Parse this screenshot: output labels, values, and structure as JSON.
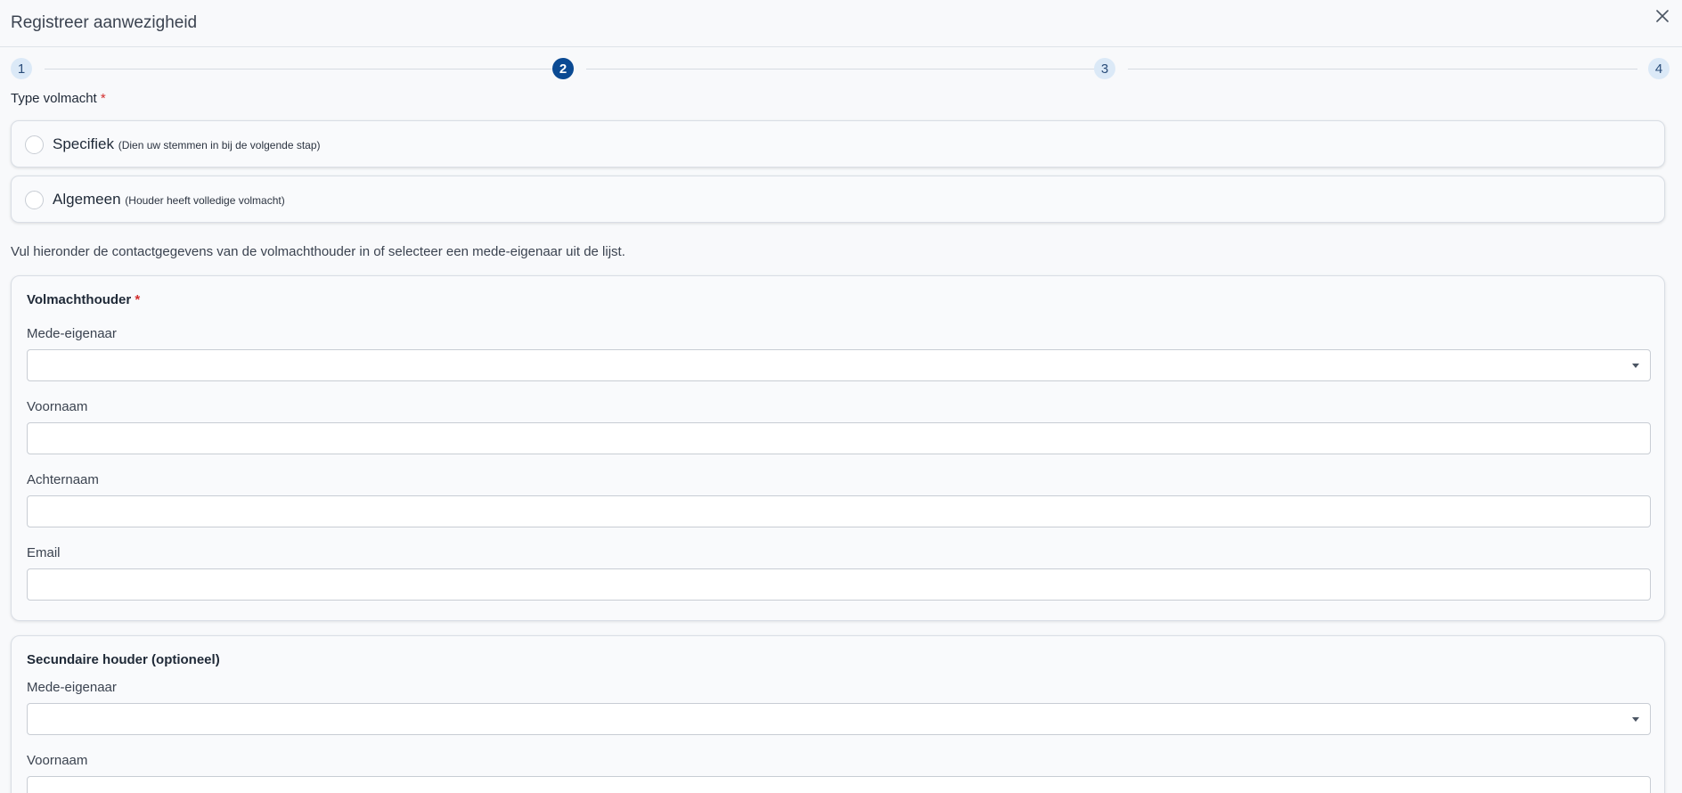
{
  "dialog": {
    "title": "Registreer aanwezigheid"
  },
  "stepper": {
    "steps": [
      {
        "label": "1",
        "state": "inactive"
      },
      {
        "label": "2",
        "state": "active"
      },
      {
        "label": "3",
        "state": "inactive"
      },
      {
        "label": "4",
        "state": "inactive"
      }
    ]
  },
  "proxy_type": {
    "label": "Type volmacht",
    "required_mark": "*",
    "options": [
      {
        "label": "Specifiek",
        "hint": "(Dien uw stemmen in bij de volgende stap)",
        "selected": false
      },
      {
        "label": "Algemeen",
        "hint": "(Houder heeft volledige volmacht)",
        "selected": false
      }
    ]
  },
  "intro_text": "Vul hieronder de contactgegevens van de volmachthouder in of selecteer een mede-eigenaar uit de lijst.",
  "primary_holder": {
    "title": "Volmachthouder",
    "required_mark": "*",
    "co_owner_label": "Mede-eigenaar",
    "co_owner_value": "",
    "first_name_label": "Voornaam",
    "first_name_value": "",
    "last_name_label": "Achternaam",
    "last_name_value": "",
    "email_label": "Email",
    "email_value": ""
  },
  "secondary_holder": {
    "title": "Secundaire houder (optioneel)",
    "co_owner_label": "Mede-eigenaar",
    "co_owner_value": "",
    "first_name_label": "Voornaam",
    "first_name_value": ""
  },
  "colors": {
    "accent": "#0b4a93",
    "step_inactive_bg": "#dbe9f7",
    "required": "#d32f2f"
  },
  "icons": {
    "close": "close-icon",
    "dropdown": "chevron-down-icon"
  }
}
